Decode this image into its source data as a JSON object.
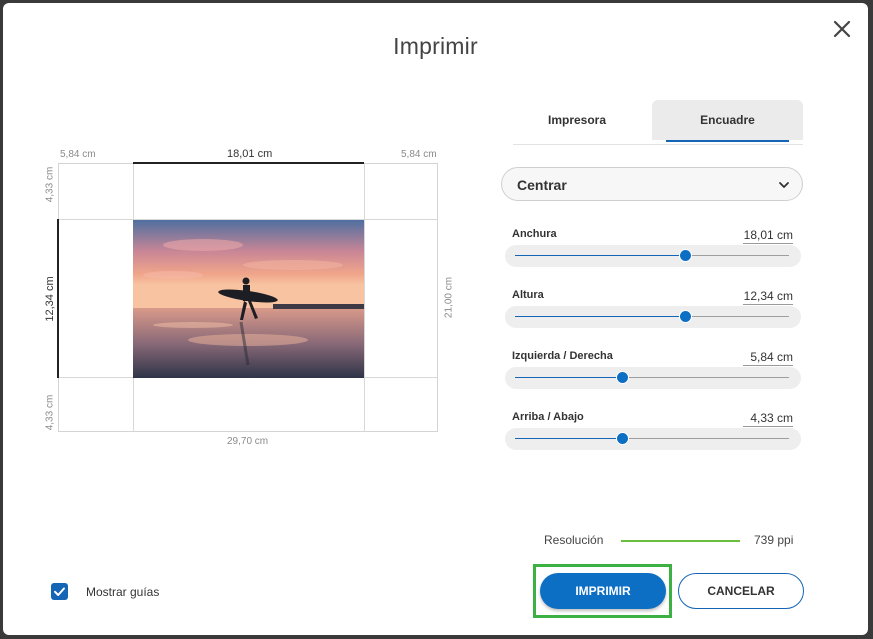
{
  "dialog": {
    "title": "Imprimir"
  },
  "preview": {
    "left_margin": "5,84 cm",
    "width": "18,01 cm",
    "right_margin": "5,84 cm",
    "top_margin": "4,33 cm",
    "height": "12,34 cm",
    "bottom_margin": "4,33 cm",
    "paper_width": "29,70 cm",
    "paper_height": "21,00 cm"
  },
  "tabs": [
    {
      "label": "Impresora",
      "active": false
    },
    {
      "label": "Encuadre",
      "active": true
    }
  ],
  "alignment": {
    "selected": "Centrar"
  },
  "sliders": [
    {
      "label": "Anchura",
      "value": "18,01 cm",
      "position": 0.62
    },
    {
      "label": "Altura",
      "value": "12,34 cm",
      "position": 0.62
    },
    {
      "label": "Izquierda / Derecha",
      "value": "5,84 cm",
      "position": 0.39
    },
    {
      "label": "Arriba / Abajo",
      "value": "4,33 cm",
      "position": 0.39
    }
  ],
  "resolution": {
    "label": "Resolución",
    "value": "739 ppi"
  },
  "guides": {
    "label": "Mostrar guías",
    "checked": true
  },
  "buttons": {
    "print": "IMPRIMIR",
    "cancel": "CANCELAR"
  },
  "colors": {
    "accent": "#1565b7",
    "resolution_ok": "#6bbf3c",
    "highlight": "#3cb043"
  }
}
